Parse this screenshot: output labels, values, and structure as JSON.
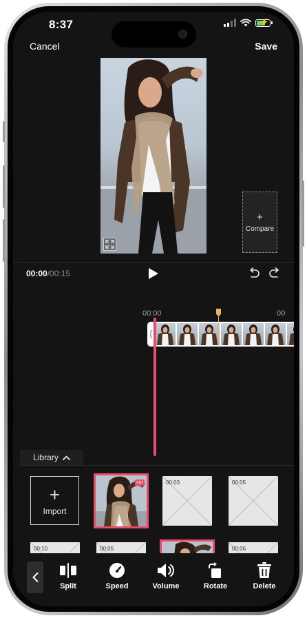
{
  "status": {
    "time": "8:37"
  },
  "topbar": {
    "cancel_label": "Cancel",
    "save_label": "Save"
  },
  "preview": {
    "compare_plus": "+",
    "compare_label": "Compare"
  },
  "playback": {
    "current_time": "00:00",
    "total_time": "/00:15"
  },
  "timeline": {
    "tick_start": "00:00",
    "tick_next": "00"
  },
  "library": {
    "tab_label": "Library",
    "import_plus": "+",
    "import_label": "Import",
    "clips": [
      {
        "duration": "",
        "badge": "cur",
        "selected": true
      },
      {
        "duration": "00:03"
      },
      {
        "duration": "00:05"
      },
      {
        "duration": "00:10"
      },
      {
        "duration": "00:05"
      },
      {
        "duration": "",
        "selected": true
      },
      {
        "duration": "00:06"
      }
    ]
  },
  "toolbar": {
    "tools": [
      {
        "label": "Split",
        "icon": "split-icon"
      },
      {
        "label": "Speed",
        "icon": "speedometer-icon"
      },
      {
        "label": "Volume",
        "icon": "speaker-icon"
      },
      {
        "label": "Rotate",
        "icon": "rotate-icon"
      },
      {
        "label": "Delete",
        "icon": "trash-icon"
      }
    ]
  },
  "colors": {
    "accent": "#e84d67",
    "marker": "#e5b46b",
    "background": "#141414"
  }
}
